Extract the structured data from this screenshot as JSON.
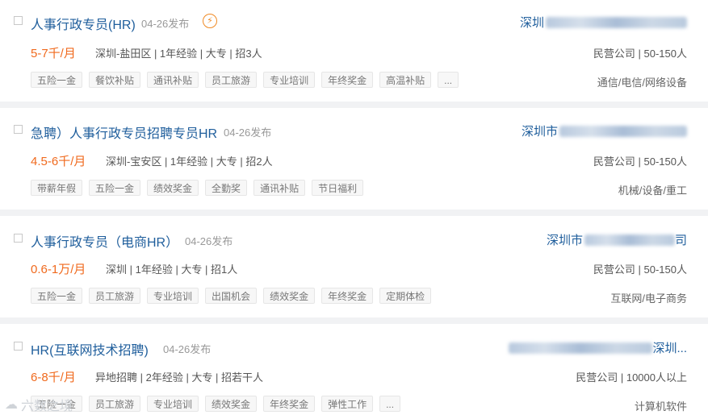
{
  "jobs": [
    {
      "title": "人事行政专员(HR)",
      "date": "04-26发布",
      "salary": "5-7千/月",
      "meta": "深圳-盐田区 | 1年经验 | 大专 | 招3人",
      "tags": [
        "五险一金",
        "餐饮补贴",
        "通讯补贴",
        "员工旅游",
        "专业培训",
        "年终奖金",
        "高温补贴",
        "..."
      ],
      "company_visible": "深圳",
      "company_type": "民营公司 | 50-150人",
      "industry": "通信/电信/网络设备",
      "urgent_icon": "lightning-icon"
    },
    {
      "title": "急聘）人事行政专员招聘专员HR",
      "date": "04-26发布",
      "salary": "4.5-6千/月",
      "meta": "深圳-宝安区 | 1年经验 | 大专 | 招2人",
      "tags": [
        "带薪年假",
        "五险一金",
        "绩效奖金",
        "全勤奖",
        "通讯补贴",
        "节日福利"
      ],
      "company_visible": "深圳市",
      "company_type": "民营公司 | 50-150人",
      "industry": "机械/设备/重工"
    },
    {
      "title": "人事行政专员（电商HR）",
      "date": "04-26发布",
      "salary": "0.6-1万/月",
      "meta": "深圳 | 1年经验 | 大专 | 招1人",
      "tags": [
        "五险一金",
        "员工旅游",
        "专业培训",
        "出国机会",
        "绩效奖金",
        "年终奖金",
        "定期体检"
      ],
      "company_visible": "深圳市",
      "company_tail": "司",
      "company_type": "民营公司 | 50-150人",
      "industry": "互联网/电子商务"
    },
    {
      "title": "HR(互联网技术招聘)",
      "date": "04-26发布",
      "salary": "6-8千/月",
      "meta": "异地招聘 | 2年经验 | 大专 | 招若干人",
      "tags": [
        "五险一金",
        "员工旅游",
        "专业培训",
        "绩效奖金",
        "年终奖金",
        "弹性工作",
        "..."
      ],
      "company_tail": "深圳...",
      "company_type": "民营公司 | 10000人以上",
      "industry": "计算机软件"
    }
  ],
  "watermark": "六数之境"
}
